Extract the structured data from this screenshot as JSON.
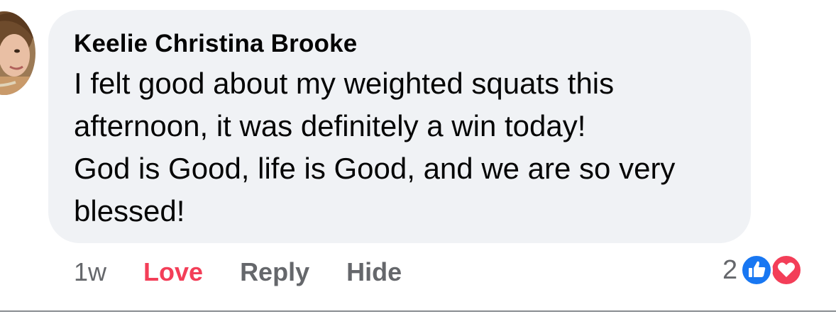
{
  "comment": {
    "author": "Keelie Christina Brooke",
    "text_lines": [
      "I felt good about my weighted squats this",
      "afternoon, it was definitely a win today!",
      "God is Good, life is Good, and we are so very",
      "blessed!"
    ]
  },
  "actions": {
    "timestamp": "1w",
    "love_label": "Love",
    "reply_label": "Reply",
    "hide_label": "Hide"
  },
  "reactions": {
    "count": "2",
    "icons": [
      "like-icon",
      "love-icon"
    ]
  },
  "colors": {
    "bubble": "#f0f2f5",
    "love": "#f33e58",
    "like": "#1877f2",
    "muted": "#65676b"
  }
}
